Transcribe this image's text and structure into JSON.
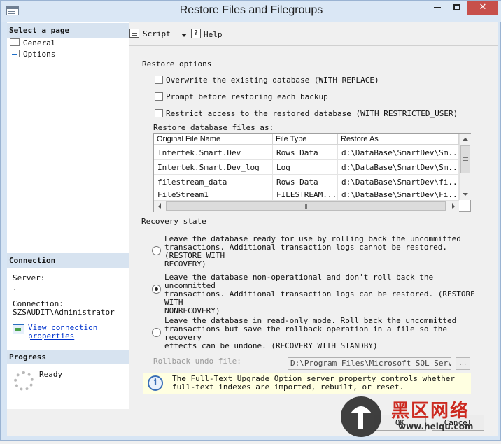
{
  "window": {
    "title": "Restore Files and Filegroups"
  },
  "left_panel": {
    "select_page_header": "Select a page",
    "pages": [
      {
        "label": "General"
      },
      {
        "label": "Options"
      }
    ],
    "connection_header": "Connection",
    "server_label": "Server:",
    "server_value": ".",
    "connection_label": "Connection:",
    "connection_value": "SZSAUDIT\\Administrator",
    "view_link_line1": "View connection",
    "view_link_line2": "properties",
    "progress_header": "Progress",
    "progress_status": "Ready"
  },
  "toolbar": {
    "script_label": "Script",
    "help_label": "Help"
  },
  "restore_options": {
    "heading": "Restore options",
    "checkboxes": [
      {
        "label": "Overwrite the existing database (WITH REPLACE)",
        "checked": false
      },
      {
        "label": "Prompt before restoring each backup",
        "checked": false
      },
      {
        "label": "Restrict access to the restored database (WITH RESTRICTED_USER)",
        "checked": false
      }
    ],
    "files_label": "Restore database files as:"
  },
  "files_grid": {
    "columns": [
      "Original File Name",
      "File Type",
      "Restore As"
    ],
    "rows": [
      [
        "Intertek.Smart.Dev",
        "Rows Data",
        "d:\\DataBase\\SmartDev\\Sm..."
      ],
      [
        "Intertek.Smart.Dev_log",
        "Log",
        "d:\\DataBase\\SmartDev\\Sm..."
      ],
      [
        "filestream_data",
        "Rows Data",
        "d:\\DataBase\\SmartDev\\fi..."
      ],
      [
        "FileStream1",
        "FILESTREAM...",
        "d:\\DataBase\\SmartDev\\Fi..."
      ]
    ]
  },
  "recovery_state": {
    "heading": "Recovery state",
    "options": [
      {
        "line1": "Leave the database ready for use by rolling back the uncommitted",
        "line2": "transactions. Additional transaction logs cannot be restored. (RESTORE WITH",
        "line3": "RECOVERY)",
        "selected": false
      },
      {
        "line1": "Leave the database non-operational and don't roll back the uncommitted",
        "line2": "transactions. Additional transaction logs can be restored. (RESTORE WITH",
        "line3": "NONRECOVERY)",
        "selected": true
      },
      {
        "line1": "Leave the database in read-only mode. Roll back the uncommitted",
        "line2": "transactions but save the rollback operation in a file so the recovery",
        "line3": "effects can be undone. (RECOVERY WITH STANDBY)",
        "selected": false
      }
    ],
    "rollback_label": "Rollback undo file:",
    "rollback_value": "D:\\Program Files\\Microsoft SQL Server\\",
    "browse_label": "..."
  },
  "info": {
    "line1": "The Full-Text Upgrade Option server property controls whether",
    "line2": "full-text indexes are imported, rebuilt, or reset."
  },
  "buttons": {
    "ok": "OK",
    "cancel": "Cancel"
  },
  "watermark": {
    "brand": "黑区网络",
    "url": "www.heiqu.com"
  }
}
